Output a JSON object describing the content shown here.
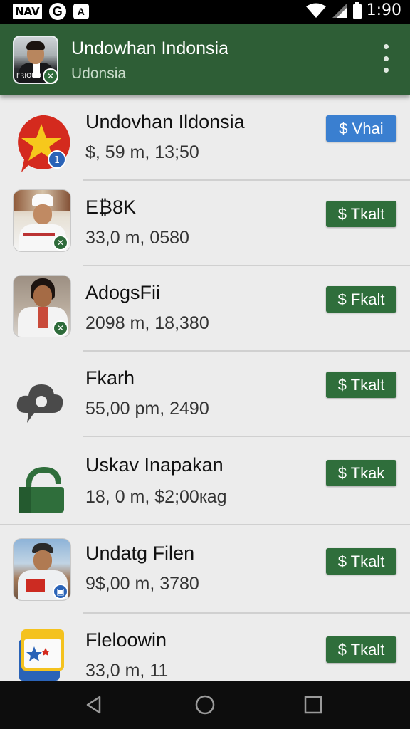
{
  "status_bar": {
    "nav_label": "NAV",
    "g_label": "G",
    "a_label": "A",
    "time": "1:90"
  },
  "app_bar": {
    "title": "Undowhan Indonsia",
    "subtitle": "Udonsia",
    "avatar_tag": "FRIQUO"
  },
  "list": {
    "items": [
      {
        "title": "Undovhan Ildonsia",
        "subtitle": "$, 59 m, 13;50",
        "button": "$ Vhai",
        "button_color": "#3a7fd0",
        "icon": "star-chat-icon"
      },
      {
        "title": "E₿8K",
        "subtitle": "33,0 m, 0580",
        "button": "$ Tkalt",
        "button_color": "#2f6e3b",
        "icon": "chef-avatar"
      },
      {
        "title": "AdogsFii",
        "subtitle": "2098 m, 18,380",
        "button": "$ Fkalt",
        "button_color": "#2f6e3b",
        "icon": "woman-avatar"
      },
      {
        "title": "Fkarh",
        "subtitle": "55,00 pm, 2490",
        "button": "$ Tkalt",
        "button_color": "#2f6e3b",
        "icon": "cloud-chat-icon"
      },
      {
        "title": "Uskav Inapakan",
        "subtitle": "18, 0 m, $2;00кag",
        "button": "$ Tkak",
        "button_color": "#2f6e3b",
        "icon": "bag-icon"
      },
      {
        "title": "Undatg Filen",
        "subtitle": "9$,00 m, 3780",
        "button": "$ Tkalt",
        "button_color": "#2f6e3b",
        "icon": "reporter-avatar"
      },
      {
        "title": "Fleloowin",
        "subtitle": "33,0 m, 11",
        "button": "$ Tkalt",
        "button_color": "#2f6e3b",
        "icon": "calendar-star-icon"
      }
    ]
  },
  "colors": {
    "app_bar": "#2e5e36",
    "primary_button": "#3a7fd0",
    "secondary_button": "#2f6e3b",
    "list_bg": "#ececec"
  }
}
